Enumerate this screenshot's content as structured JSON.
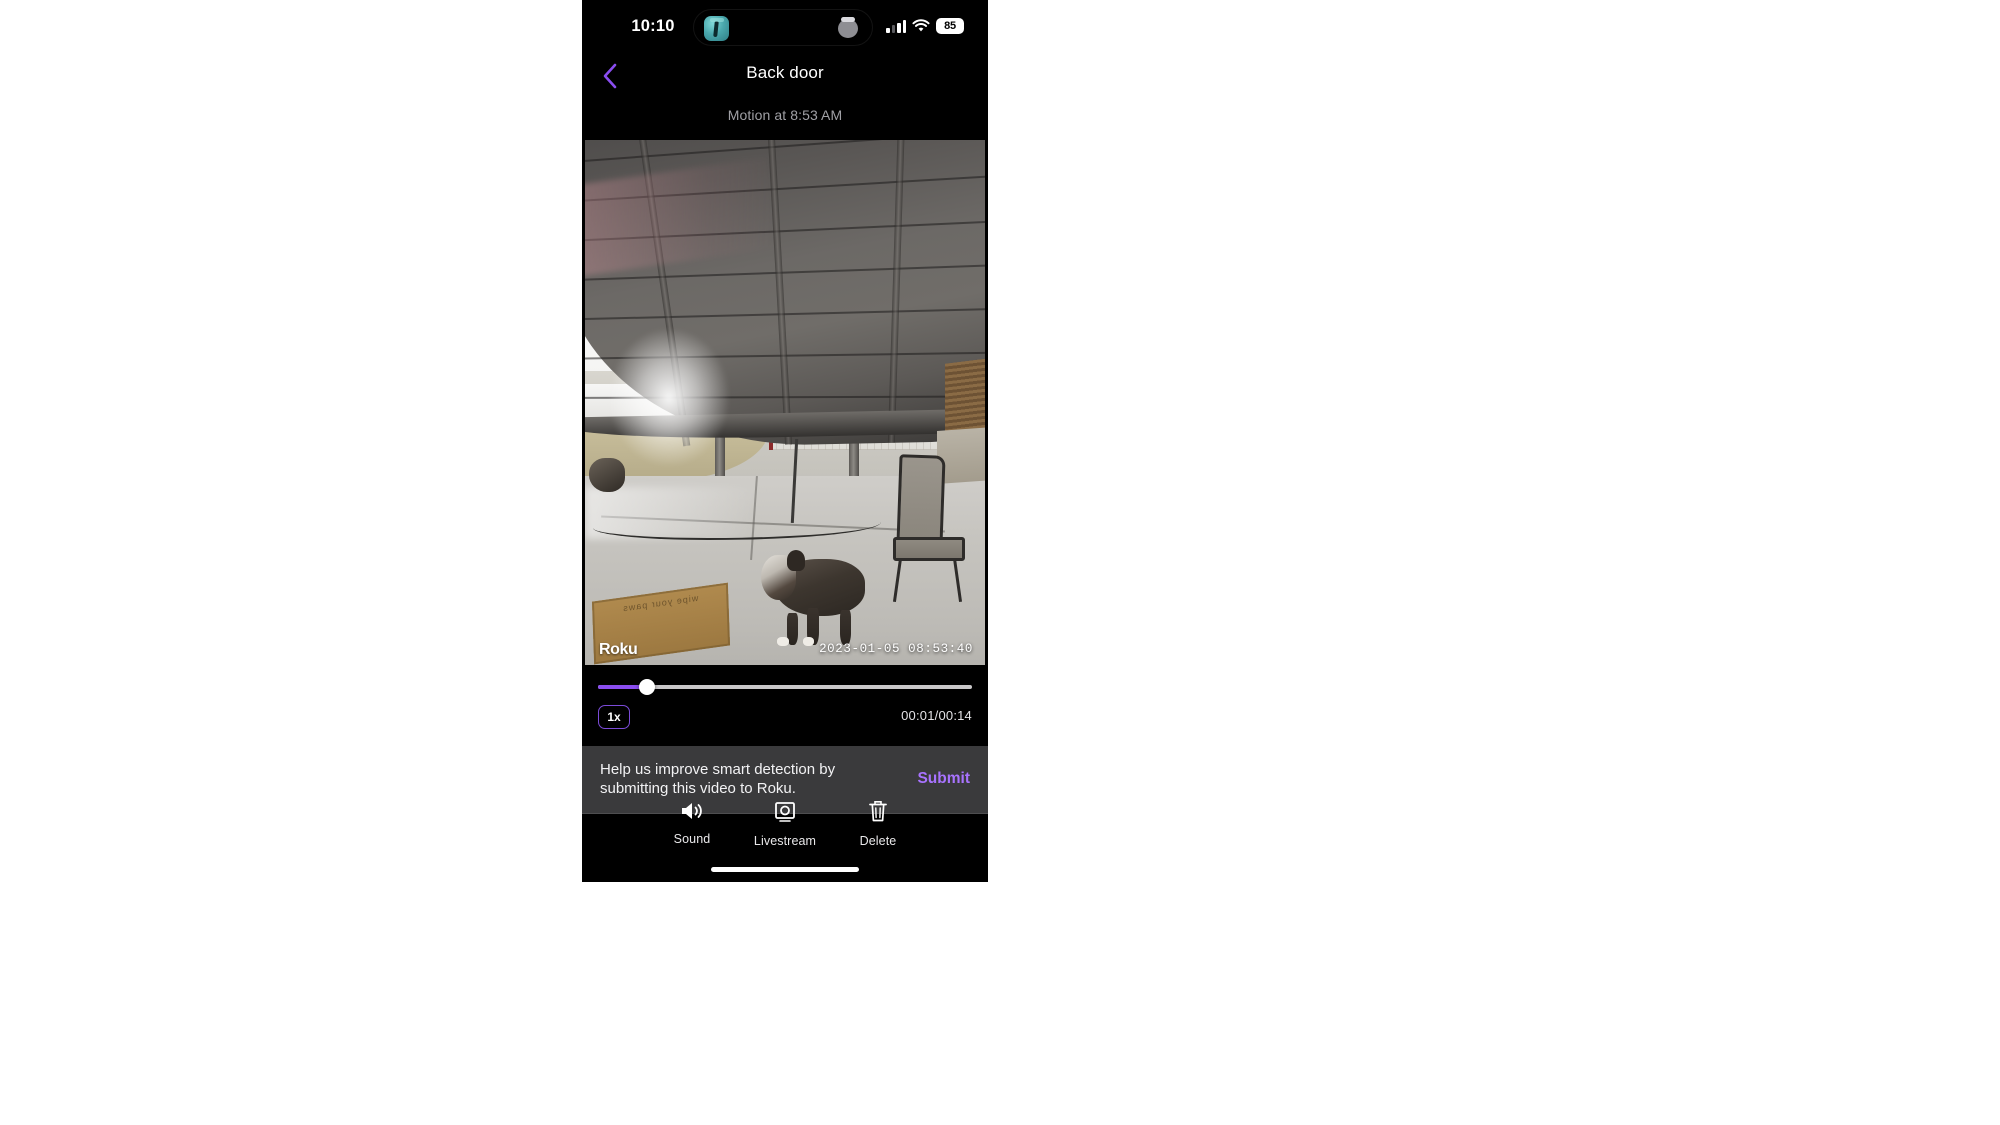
{
  "status_bar": {
    "time": "10:10",
    "battery_percent": "85",
    "signal_icon": "cellular-signal-icon",
    "wifi_icon": "wifi-icon",
    "dynamic_island_app_icon": "camera-app-icon",
    "dynamic_island_indicator": "recording-indicator"
  },
  "header": {
    "back_icon": "chevron-left-icon",
    "title": "Back door",
    "subtitle": "Motion at 8:53 AM"
  },
  "video": {
    "watermark": "Roku",
    "timestamp": "2023-01-05  08:53:40",
    "scene_description": "Covered patio camera view with a dog walking across concrete, doormat, patio chairs, metal barn and fenced yard"
  },
  "player": {
    "progress_percent": 13,
    "speed_label": "1x",
    "time_label": "00:01/00:14"
  },
  "banner": {
    "message": "Help us improve smart detection by submitting this video to Roku.",
    "submit_label": "Submit"
  },
  "toolbar": {
    "items": [
      {
        "label": "Sound",
        "icon": "speaker-icon"
      },
      {
        "label": "Livestream",
        "icon": "camera-icon"
      },
      {
        "label": "Delete",
        "icon": "trash-icon"
      }
    ]
  },
  "colors": {
    "accent_purple": "#8a4df0",
    "submit_purple": "#a873ff",
    "banner_bg": "#3a3a3c",
    "background": "#000000"
  }
}
